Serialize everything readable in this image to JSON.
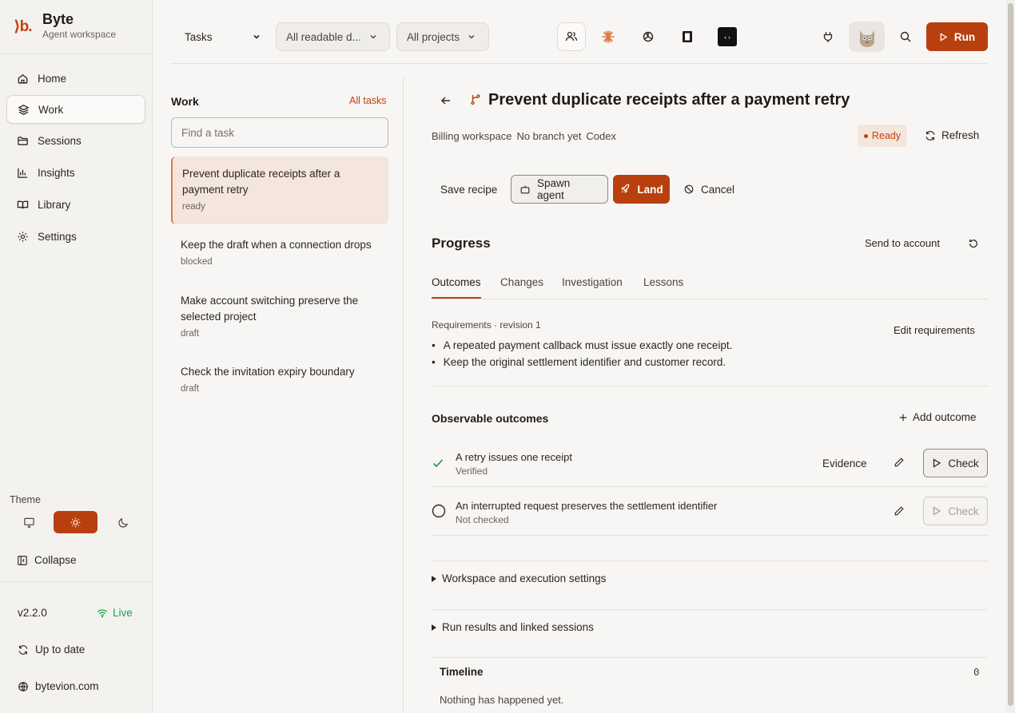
{
  "brand": {
    "mark": "⟩b.",
    "title": "Byte",
    "subtitle": "Agent workspace"
  },
  "nav": {
    "items": [
      {
        "label": "Home",
        "icon": "home-icon"
      },
      {
        "label": "Work",
        "icon": "layers-icon",
        "active": true
      },
      {
        "label": "Sessions",
        "icon": "folder-icon"
      },
      {
        "label": "Insights",
        "icon": "bar-chart-icon"
      },
      {
        "label": "Library",
        "icon": "book-icon"
      },
      {
        "label": "Settings",
        "icon": "gear-icon"
      }
    ]
  },
  "theme": {
    "label": "Theme",
    "selected": "light"
  },
  "sidebar_footer": {
    "collapse": "Collapse",
    "version": "v2.2.0",
    "live": "Live",
    "update": "Up to date",
    "site": "bytevion.com"
  },
  "topbar": {
    "mode": "Tasks",
    "filter_docs": "All readable d...",
    "filter_projects": "All projects",
    "run_label": "Run"
  },
  "work": {
    "title": "Work",
    "all_link": "All tasks",
    "search_placeholder": "Find a task",
    "tasks": [
      {
        "title": "Prevent duplicate receipts after a payment retry",
        "status": "ready"
      },
      {
        "title": "Keep the draft when a connection drops",
        "status": "blocked"
      },
      {
        "title": "Make account switching preserve the selected project",
        "status": "draft"
      },
      {
        "title": "Check the invitation expiry boundary",
        "status": "draft"
      }
    ]
  },
  "detail": {
    "title": "Prevent duplicate receipts after a payment retry",
    "workspace": "Billing workspace",
    "branch": "No branch yet",
    "agent": "Codex",
    "status": "Ready",
    "refresh": "Refresh",
    "actions": {
      "save_recipe": "Save recipe",
      "spawn_agent": "Spawn agent",
      "land": "Land",
      "cancel": "Cancel"
    },
    "progress": {
      "title": "Progress",
      "send": "Send to account",
      "tabs": [
        "Outcomes",
        "Changes",
        "Investigation",
        "Lessons"
      ]
    },
    "requirements": {
      "meta": "Requirements · revision 1",
      "edit": "Edit requirements",
      "items": [
        "A repeated payment callback must issue exactly one receipt.",
        "Keep the original settlement identifier and customer record."
      ]
    },
    "outcomes": {
      "title": "Observable outcomes",
      "add": "Add outcome",
      "evidence": "Evidence",
      "check": "Check",
      "items": [
        {
          "title": "A retry issues one receipt",
          "status": "Verified"
        },
        {
          "title": "An interrupted request preserves the settlement identifier",
          "status": "Not checked"
        }
      ]
    },
    "sections": {
      "workspace": "Workspace and execution settings",
      "results": "Run results and linked sessions"
    },
    "timeline": {
      "title": "Timeline",
      "count": "0",
      "empty": "Nothing has happened yet."
    }
  },
  "colors": {
    "accent": "#b8400f",
    "ok": "#1f8a5b",
    "live": "#16a34a"
  }
}
